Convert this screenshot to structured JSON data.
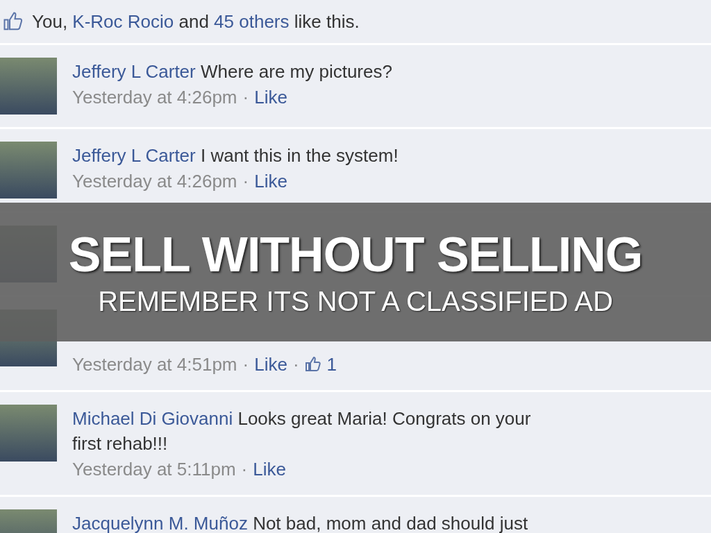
{
  "likes_bar": {
    "text": "You, ",
    "people": [
      {
        "name": "K-Roc Rocio"
      },
      {
        "name": "45 others"
      }
    ],
    "joiner": " and ",
    "tail": " like this."
  },
  "comments": [
    {
      "kind": "comment",
      "author": "Jeffery L Carter",
      "text": "Where are my pictures?",
      "time": "Yesterday at 4:26pm",
      "separator": "·",
      "like": "Like"
    },
    {
      "kind": "comment",
      "author": "Jeffery L Carter",
      "text": "I want this in the system!",
      "time": "Yesterday at 4:26pm",
      "separator": "·",
      "like": "Like"
    },
    {
      "kind": "covered"
    },
    {
      "kind": "covered",
      "time": "Yesterday at 4:51pm",
      "separator": "·",
      "like": "Like",
      "likes_separator": "·",
      "likes": "1"
    },
    {
      "kind": "comment",
      "author": "Michael Di Giovanni",
      "text": "Looks great Maria! Congrats on your first rehab!!!",
      "time": "Yesterday at 5:11pm",
      "separator": "·",
      "like": "Like"
    },
    {
      "kind": "comment",
      "author": "Jacquelynn M. Muñoz",
      "text": "Not bad, mom and dad should just"
    }
  ],
  "banner": {
    "title": "SELL WITHOUT SELLING",
    "subtitle": "REMEMBER ITS NOT A CLASSIFIED AD"
  }
}
